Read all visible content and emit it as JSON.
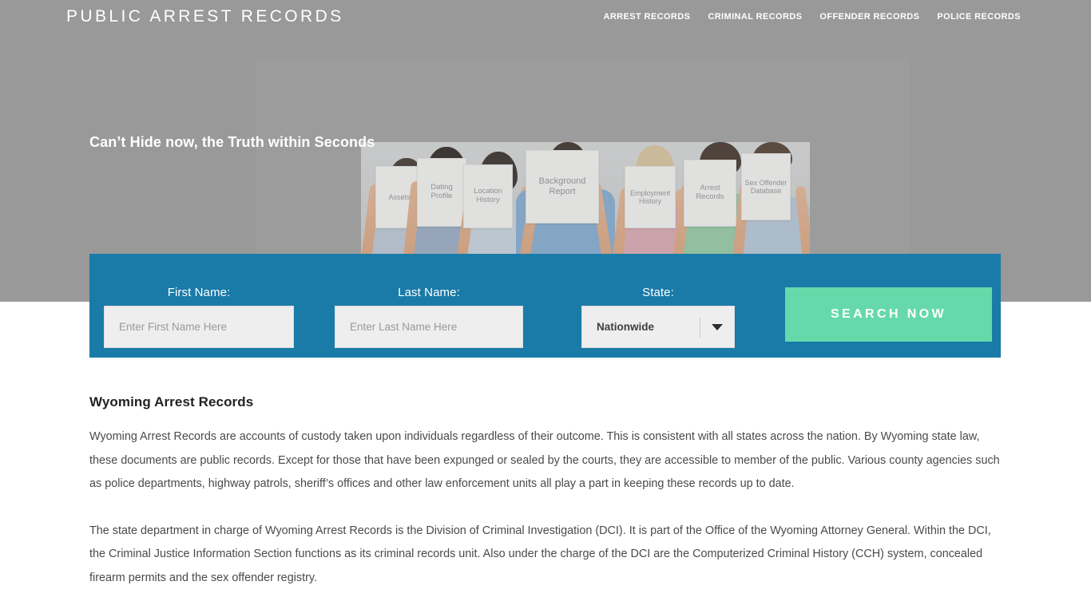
{
  "header": {
    "brand": "PUBLIC ARREST RECORDS",
    "nav": [
      {
        "label": "ARREST RECORDS"
      },
      {
        "label": "CRIMINAL RECORDS"
      },
      {
        "label": "OFFENDER RECORDS"
      },
      {
        "label": "POLICE RECORDS"
      }
    ]
  },
  "hero": {
    "tagline": "Can’t Hide now, the Truth within Seconds",
    "photo_signs": [
      {
        "text": "Assets"
      },
      {
        "text": "Dating Profile"
      },
      {
        "text": "Location History"
      },
      {
        "text": "Background Report"
      },
      {
        "text": "Employment History"
      },
      {
        "text": "Arrest Records"
      },
      {
        "text": "Sex Offender Database"
      }
    ]
  },
  "search_form": {
    "first_name": {
      "label": "First Name:",
      "placeholder": "Enter First Name Here",
      "value": ""
    },
    "last_name": {
      "label": "Last Name:",
      "placeholder": "Enter Last Name Here",
      "value": ""
    },
    "state": {
      "label": "State:",
      "selected": "Nationwide"
    },
    "submit_label": "SEARCH NOW"
  },
  "article": {
    "title": "Wyoming Arrest Records",
    "paragraphs": [
      "Wyoming Arrest Records are accounts of custody taken upon individuals regardless of their outcome. This is consistent with all states across the nation. By Wyoming state law, these documents are public records. Except for those that have been expunged or sealed by the courts, they are accessible to member of the public. Various county agencies such as police departments, highway patrols, sheriff’s offices and other law enforcement units all play a part in keeping these records up to date.",
      "The state department in charge of Wyoming Arrest Records is the Division of Criminal Investigation (DCI). It is part of the Office of the Wyoming Attorney General. Within the DCI, the Criminal Justice Information Section functions as its criminal records unit. Also under the charge of the DCI are the Computerized Criminal History (CCH) system, concealed firearm permits and the sex offender registry."
    ]
  },
  "colors": {
    "hero_gray": "#999999",
    "form_blue": "#1a7ba8",
    "button_green": "#66d9ab",
    "input_gray": "#eeeeee",
    "text_dark": "#4a4a4a"
  }
}
